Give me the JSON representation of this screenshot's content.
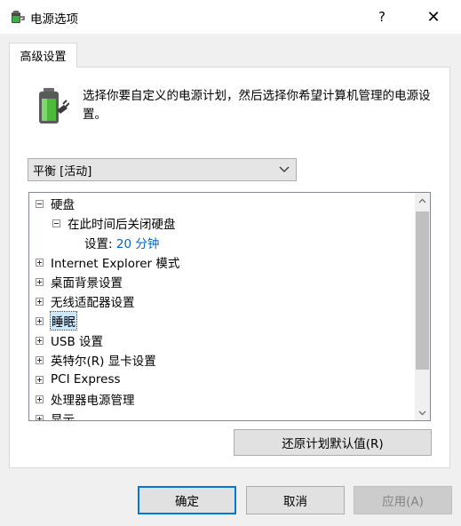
{
  "window": {
    "title": "电源选项",
    "help_label": "?",
    "close_label": "✕"
  },
  "tabs": [
    {
      "label": "高级设置"
    }
  ],
  "description": "选择你要自定义的电源计划，然后选择你希望计算机管理的电源设置。",
  "plan_select": {
    "value": "平衡 [活动]"
  },
  "tree": {
    "items": [
      {
        "label": "硬盘",
        "toggle": "minus"
      },
      {
        "label": "在此时间后关闭硬盘",
        "toggle": "minus"
      },
      {
        "label": "设置:",
        "value": "20 分钟"
      },
      {
        "label": "Internet Explorer 模式",
        "toggle": "plus"
      },
      {
        "label": "桌面背景设置",
        "toggle": "plus"
      },
      {
        "label": "无线适配器设置",
        "toggle": "plus"
      },
      {
        "label": "睡眠",
        "toggle": "plus"
      },
      {
        "label": "USB 设置",
        "toggle": "plus"
      },
      {
        "label": "英特尔(R) 显卡设置",
        "toggle": "plus"
      },
      {
        "label": "PCI Express",
        "toggle": "plus"
      },
      {
        "label": "处理器电源管理",
        "toggle": "plus"
      },
      {
        "label": "显示",
        "toggle": "plus"
      }
    ]
  },
  "buttons": {
    "restore": "还原计划默认值(R)",
    "ok": "确定",
    "cancel": "取消",
    "apply": "应用(A)"
  },
  "colors": {
    "accent": "#0078d7",
    "value_text": "#0066cc",
    "selection": "#cce8ff"
  }
}
